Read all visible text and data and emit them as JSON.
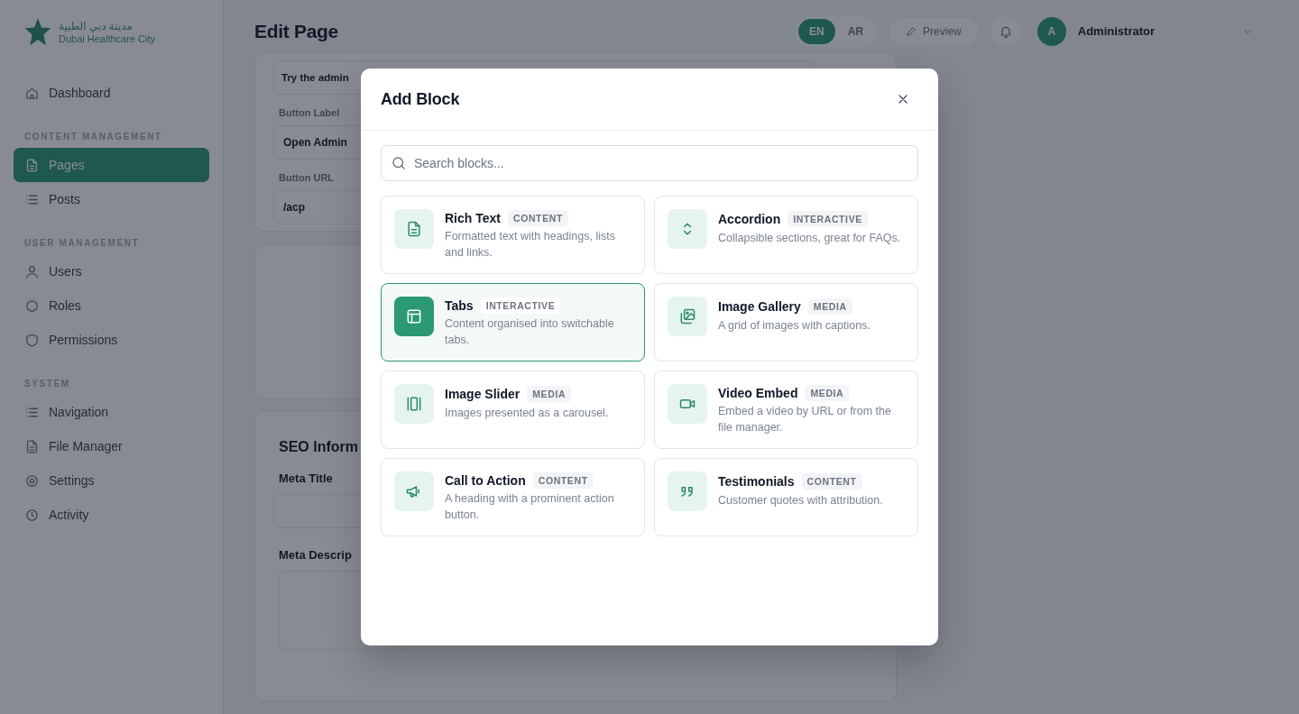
{
  "sidebar": {
    "logo_text_ar": "مدينة دبي الطبية",
    "logo_text": "Dubai Healthcare City",
    "sections": [
      {
        "items": [
          {
            "label": "Dashboard",
            "selected": false
          }
        ]
      },
      {
        "heading": "CONTENT MANAGEMENT",
        "items": [
          {
            "label": "Pages",
            "selected": true
          },
          {
            "label": "Posts",
            "selected": false
          }
        ]
      },
      {
        "heading": "USER MANAGEMENT",
        "items": [
          {
            "label": "Users",
            "selected": false
          },
          {
            "label": "Roles",
            "selected": false
          },
          {
            "label": "Permissions",
            "selected": false
          }
        ]
      },
      {
        "heading": "SYSTEM",
        "items": [
          {
            "label": "Navigation",
            "selected": false
          },
          {
            "label": "File Manager",
            "selected": false
          },
          {
            "label": "Settings",
            "selected": false
          },
          {
            "label": "Activity",
            "selected": false
          }
        ]
      }
    ]
  },
  "header": {
    "title": "Edit Page",
    "languages": [
      {
        "label": "EN",
        "selected": true
      },
      {
        "label": "AR",
        "selected": false
      }
    ],
    "preview": "Preview",
    "user": {
      "initial": "A",
      "name": "Administrator"
    }
  },
  "form_card": {
    "fields": [
      {
        "value": "Try the admin"
      },
      {
        "label": "Button Label",
        "value": "Open Admin"
      },
      {
        "label": "Button URL",
        "value": "/acp"
      }
    ]
  },
  "seo_card": {
    "title": "SEO Inform",
    "fields": [
      {
        "label": "Meta Title",
        "kind": "input"
      },
      {
        "label": "Meta Descrip",
        "kind": "textarea"
      }
    ]
  },
  "modal": {
    "title": "Add Block",
    "search": {
      "placeholder": "Search blocks..."
    },
    "blocks": [
      {
        "name": "Rich Text",
        "badge": "CONTENT",
        "description": "Formatted text with headings, lists and links.",
        "selected": false
      },
      {
        "name": "Accordion",
        "badge": "INTERACTIVE",
        "description": "Collapsible sections, great for FAQs.",
        "selected": false
      },
      {
        "name": "Tabs",
        "badge": "INTERACTIVE",
        "description": "Content organised into switchable tabs.",
        "selected": true
      },
      {
        "name": "Image Gallery",
        "badge": "MEDIA",
        "description": "A grid of images with captions.",
        "selected": false
      },
      {
        "name": "Image Slider",
        "badge": "MEDIA",
        "description": "Images presented as a carousel.",
        "selected": false
      },
      {
        "name": "Video Embed",
        "badge": "MEDIA",
        "description": "Embed a video by URL or from the file manager.",
        "selected": false
      },
      {
        "name": "Call to Action",
        "badge": "CONTENT",
        "description": "A heading with a prominent action button.",
        "selected": false
      },
      {
        "name": "Testimonials",
        "badge": "CONTENT",
        "description": "Customer quotes with attribution.",
        "selected": false
      }
    ]
  }
}
